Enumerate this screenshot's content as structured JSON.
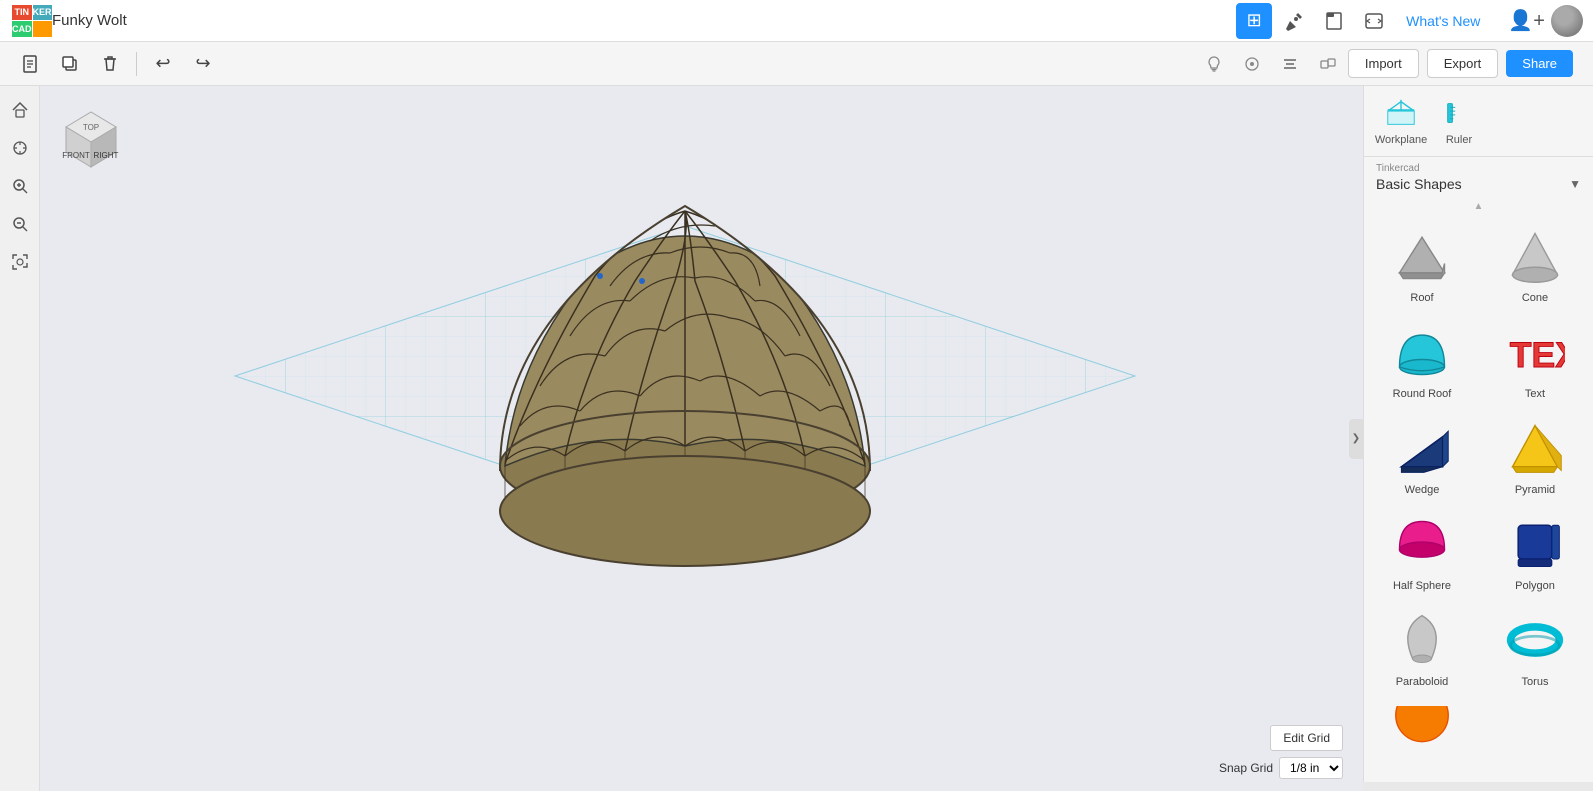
{
  "app": {
    "logo_cells": [
      "TIN",
      "KER",
      "CAD",
      ""
    ],
    "title": "Funky Wolt"
  },
  "nav": {
    "whats_new": "What's New",
    "icons": [
      "⊞",
      "🔨",
      "📁",
      "{}"
    ]
  },
  "toolbar": {
    "new_btn": "📄",
    "duplicate_btn": "⧉",
    "delete_btn": "🗑",
    "undo_btn": "↩",
    "redo_btn": "↪",
    "import_label": "Import",
    "export_label": "Export",
    "share_label": "Share"
  },
  "left_panel": {
    "buttons": [
      "🏠",
      "⊙",
      "+",
      "−",
      "⊕"
    ]
  },
  "viewport": {
    "edit_grid_label": "Edit Grid",
    "snap_grid_label": "Snap Grid",
    "snap_grid_value": "1/8 in"
  },
  "right_panel": {
    "workplane_label": "Workplane",
    "ruler_label": "Ruler",
    "category_brand": "Tinkercad",
    "category_name": "Basic Shapes",
    "shapes": [
      {
        "label": "Roof",
        "color": "#b0b0b0",
        "type": "roof"
      },
      {
        "label": "Cone",
        "color": "#c8c8c8",
        "type": "cone"
      },
      {
        "label": "Round Roof",
        "color": "#26c6da",
        "type": "round_roof"
      },
      {
        "label": "Text",
        "color": "#e53935",
        "type": "text"
      },
      {
        "label": "Wedge",
        "color": "#1a3a7a",
        "type": "wedge"
      },
      {
        "label": "Pyramid",
        "color": "#f5c518",
        "type": "pyramid"
      },
      {
        "label": "Half Sphere",
        "color": "#e91e8c",
        "type": "half_sphere"
      },
      {
        "label": "Polygon",
        "color": "#1a3a9a",
        "type": "polygon"
      },
      {
        "label": "Paraboloid",
        "color": "#bdbdbd",
        "type": "paraboloid"
      },
      {
        "label": "Torus",
        "color": "#00bcd4",
        "type": "torus"
      }
    ]
  }
}
